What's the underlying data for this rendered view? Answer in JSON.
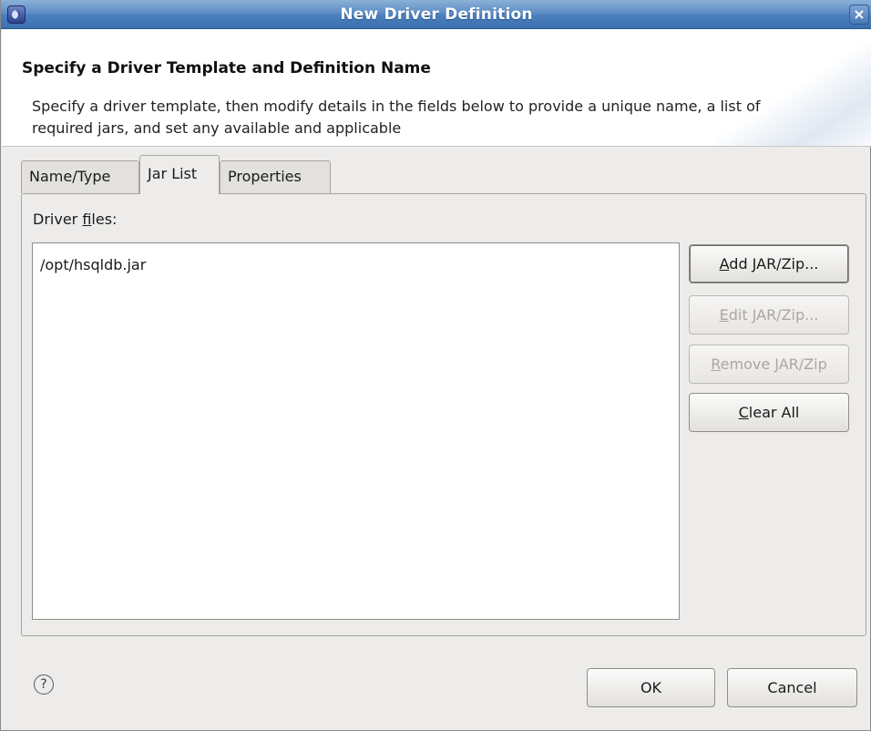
{
  "window": {
    "title": "New Driver Definition",
    "close_symbol": "×"
  },
  "header": {
    "title": "Specify a Driver Template and Definition Name",
    "description": "Specify a driver template, then modify details in the fields below to provide a unique name, a list of required jars, and set any available and applicable"
  },
  "tabs": [
    {
      "label": "Name/Type",
      "active": false
    },
    {
      "label": "Jar List",
      "active": true
    },
    {
      "label": "Properties",
      "active": false
    }
  ],
  "jar_list": {
    "label_prefix": "Driver ",
    "label_mnemonic": "f",
    "label_suffix": "iles:",
    "files": [
      "/opt/hsqldb.jar"
    ],
    "buttons": {
      "add": {
        "mnemonic": "A",
        "rest": "dd JAR/Zip...",
        "enabled": true
      },
      "edit": {
        "mnemonic": "E",
        "rest": "dit JAR/Zip...",
        "enabled": false
      },
      "remove": {
        "mnemonic": "R",
        "rest": "emove JAR/Zip",
        "enabled": false
      },
      "clear": {
        "mnemonic": "C",
        "rest": "lear All",
        "enabled": true
      }
    }
  },
  "footer": {
    "help_icon": "question-mark-icon",
    "help_symbol": "?",
    "ok_label": "OK",
    "cancel_label": "Cancel"
  },
  "colors": {
    "titlebar": "#4a7fbd",
    "window_bg": "#edeceb",
    "disabled_text": "#a9a7a3"
  }
}
